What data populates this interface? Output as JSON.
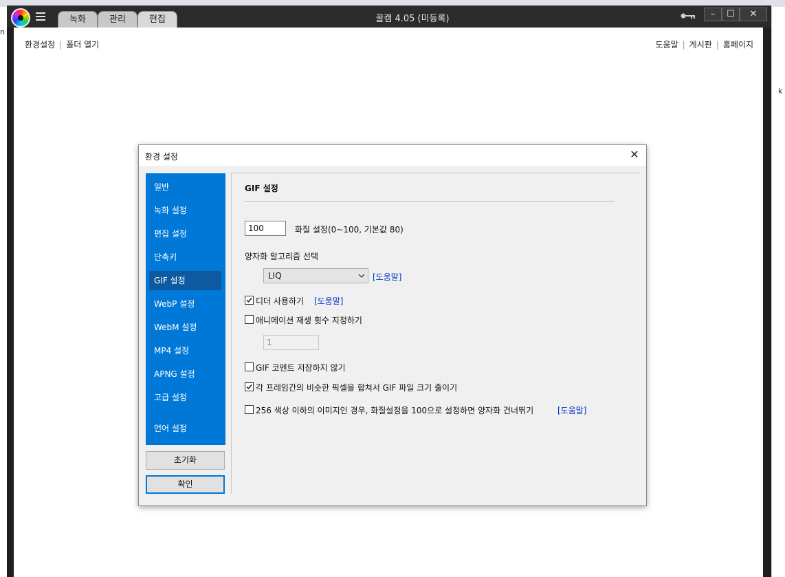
{
  "app": {
    "title": "꿀캠 4.05 (미등록)",
    "tabs": [
      "녹화",
      "관리",
      "편집"
    ],
    "window_controls": {
      "minimize": "–",
      "maximize": "☐",
      "close": "✕"
    }
  },
  "toolbar": {
    "left": [
      "환경설정",
      "폴더 열기"
    ],
    "right": [
      "도움말",
      "게시판",
      "홈페이지"
    ]
  },
  "dialog": {
    "title": "환경 설정",
    "sidebar": {
      "items": [
        "일반",
        "녹화 설정",
        "편집 설정",
        "단축키",
        "GIF 설정",
        "WebP 설정",
        "WebM 설정",
        "MP4 설정",
        "APNG 설정",
        "고급 설정",
        "언어 설정"
      ],
      "active_index": 4
    },
    "buttons": {
      "reset": "초기화",
      "ok": "확인"
    },
    "panel": {
      "title": "GIF 설정",
      "quality": {
        "value": "100",
        "label": "화질 설정(0~100, 기본값 80)"
      },
      "quantizer": {
        "label": "양자화 알고리즘 선택",
        "selected": "LIQ",
        "help": "[도움말]"
      },
      "options": [
        {
          "label": "디더 사용하기",
          "checked": true,
          "help": "[도움말]"
        },
        {
          "label": "애니메이션 재생 횟수 지정하기",
          "checked": false
        },
        {
          "label": "GIF 코멘트 저장하지 않기",
          "checked": false
        },
        {
          "label": "각 프레임간의 비슷한 픽셀을 합쳐서 GIF 파일 크기 줄이기",
          "checked": true
        },
        {
          "label": "256 색상 이하의 이미지인 경우, 화질설정을 100으로 설정하면 양자화 건너뛰기",
          "checked": false,
          "help": "[도움말]"
        }
      ],
      "loop_count": {
        "value": "1"
      }
    }
  },
  "background": {
    "left_fragment": "n",
    "right_fragment": "k"
  },
  "colors": {
    "sidebar": "#0078d7",
    "sidebar_active": "#0d5aa0",
    "link": "#0033cc",
    "titlebar": "#2b2b2b"
  }
}
